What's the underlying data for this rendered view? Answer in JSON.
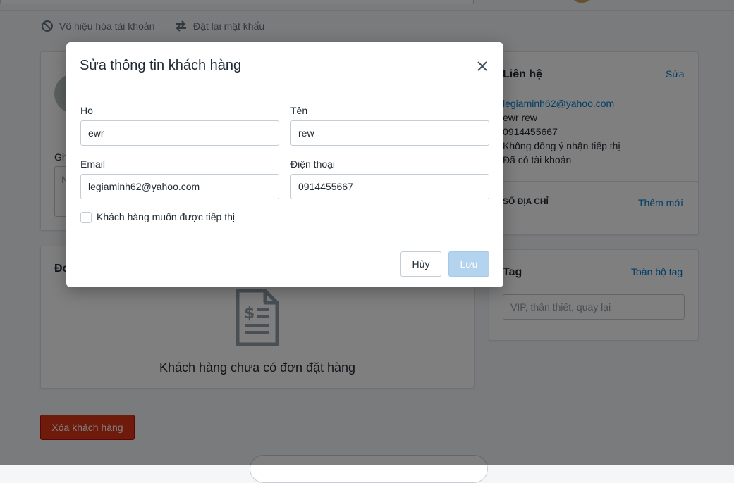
{
  "colors": {
    "accent": "#007ace",
    "danger": "#de3618",
    "save_disabled": "#b4d3ee"
  },
  "page_actions": {
    "deactivate_label": "Vô hiệu hóa tài khoản",
    "deactivate_icon": "ban-icon",
    "reset_password_label": "Đặt lại mật khẩu",
    "reset_password_icon": "swap-arrows-icon"
  },
  "note_card": {
    "label": "Gh",
    "placeholder": "N"
  },
  "orders_card": {
    "title": "Đơ",
    "empty_icon": "invoice-document-icon",
    "empty_text": "Khách hàng chưa có đơn đặt hàng"
  },
  "contact_card": {
    "title": "Liên hệ",
    "edit_link": "Sửa",
    "email": "legiaminh62@yahoo.com",
    "name": "ewr rew",
    "phone": "0914455667",
    "marketing": "Không đồng ý nhận tiếp thị",
    "account_status": "Đã có tài khoản",
    "address_heading": "SỐ ĐỊA CHỈ",
    "add_new_link": "Thêm mới"
  },
  "tag_card": {
    "title": "Tag",
    "all_tags_link": "Toàn bộ tag",
    "input_placeholder": "VIP, thân thiết, quay lại"
  },
  "delete_button_label": "Xóa khách hàng",
  "modal": {
    "title": "Sửa thông tin khách hàng",
    "close_icon": "close-icon",
    "last_name_label": "Họ",
    "last_name_value": "ewr",
    "first_name_label": "Tên",
    "first_name_value": "rew",
    "email_label": "Email",
    "email_value": "legiaminh62@yahoo.com",
    "phone_label": "Điện thoại",
    "phone_value": "0914455667",
    "marketing_checkbox_label": "Khách hàng muốn được tiếp thị",
    "cancel_label": "Hủy",
    "save_label": "Lưu"
  }
}
